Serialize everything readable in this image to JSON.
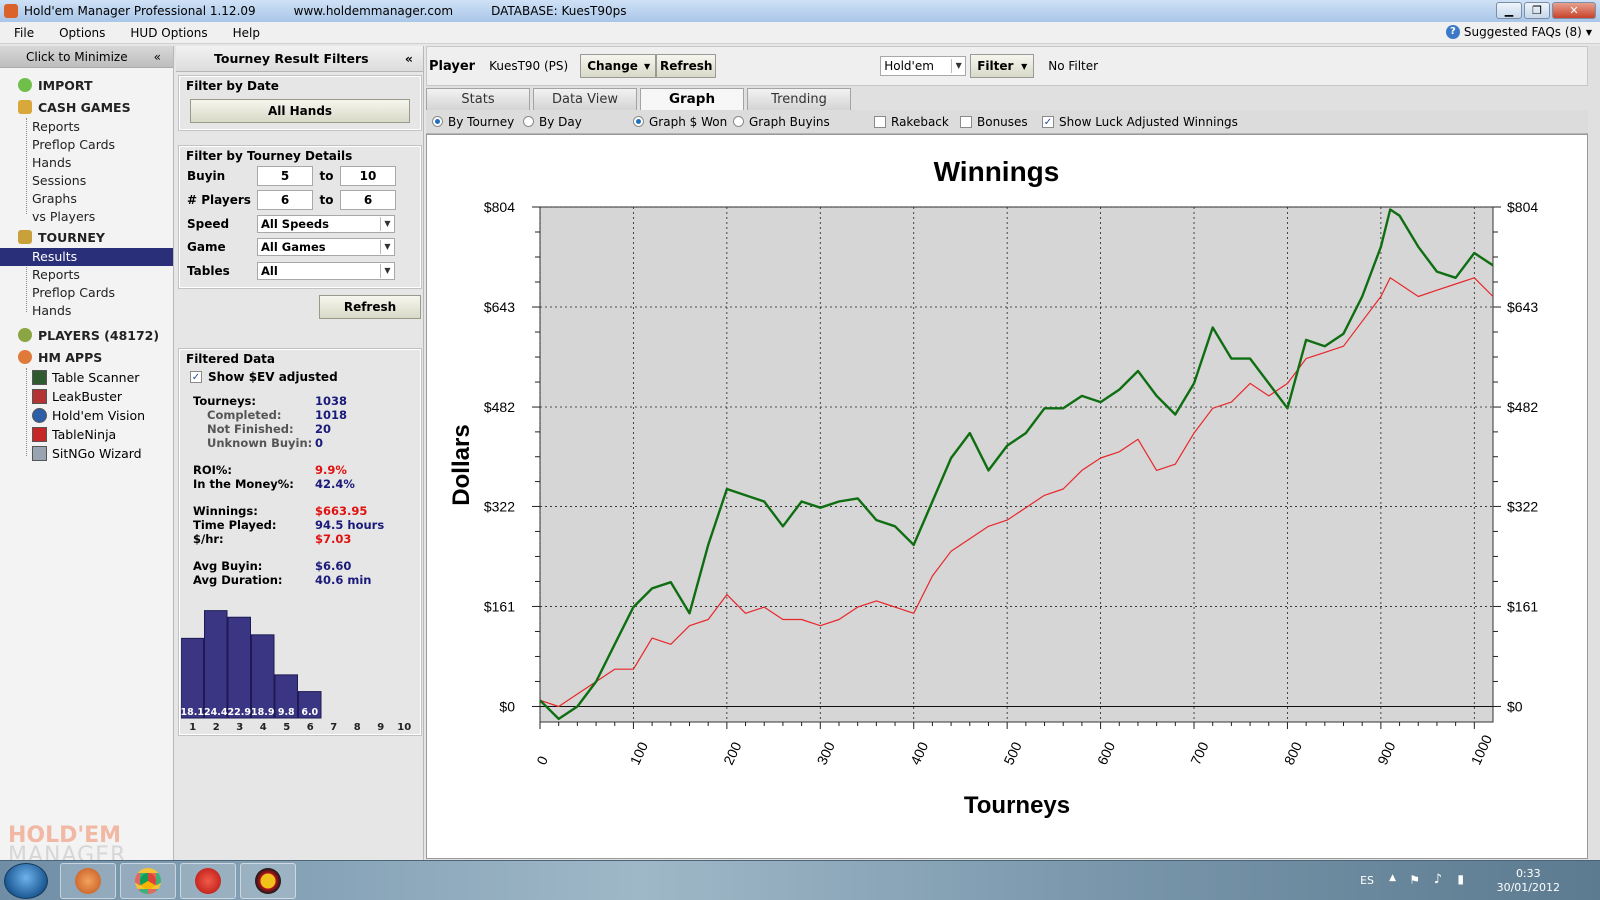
{
  "window": {
    "app_name": "Hold'em Manager Professional 1.12.09",
    "url": "www.holdemmanager.com",
    "database": "DATABASE: KuesT90ps"
  },
  "menu": [
    "File",
    "Options",
    "HUD Options",
    "Help"
  ],
  "faq": "Suggested FAQs (8)",
  "nav": {
    "minimize": "Click to Minimize",
    "import": "IMPORT",
    "cash_games": "CASH GAMES",
    "cash_items": [
      "Reports",
      "Preflop Cards",
      "Hands",
      "Sessions",
      "Graphs",
      "vs Players"
    ],
    "tourney": "TOURNEY",
    "tourney_items": [
      "Results",
      "Reports",
      "Preflop Cards",
      "Hands"
    ],
    "players": "PLAYERS (48172)",
    "hm_apps": "HM APPS",
    "apps": [
      "Table Scanner",
      "LeakBuster",
      "Hold'em Vision",
      "TableNinja",
      "SitNGo Wizard"
    ],
    "brand_top": "HOLD'EM",
    "brand_bottom": "MANAGER"
  },
  "filters": {
    "title": "Tourney Result Filters",
    "by_date_title": "Filter by Date",
    "all_hands": "All Hands",
    "details_title": "Filter by Tourney Details",
    "buyin_label": "Buyin",
    "buyin_from": "5",
    "buyin_to": "10",
    "to": "to",
    "players_label": "# Players",
    "players_from": "6",
    "players_to": "6",
    "speed_label": "Speed",
    "speed_value": "All Speeds",
    "game_label": "Game",
    "game_value": "All Games",
    "tables_label": "Tables",
    "tables_value": "All",
    "refresh": "Refresh",
    "filtered_title": "Filtered Data",
    "show_sev": "Show $EV adjusted",
    "stats": {
      "tourneys_k": "Tourneys:",
      "tourneys_v": "1038",
      "completed_k": "Completed:",
      "completed_v": "1018",
      "not_finished_k": "Not Finished:",
      "not_finished_v": "20",
      "unknown_k": "Unknown Buyin:",
      "unknown_v": "0",
      "roi_k": "ROI%:",
      "roi_v": "9.9%",
      "itm_k": "In the Money%:",
      "itm_v": "42.4%",
      "winnings_k": "Winnings:",
      "winnings_v": "$663.95",
      "time_k": "Time Played:",
      "time_v": "94.5 hours",
      "hourly_k": "$/hr:",
      "hourly_v": "$7.03",
      "avg_buyin_k": "Avg Buyin:",
      "avg_buyin_v": "$6.60",
      "avg_dur_k": "Avg Duration:",
      "avg_dur_v": "40.6 min"
    },
    "histogram": {
      "positions": [
        "1",
        "2",
        "3",
        "4",
        "5",
        "6",
        "7",
        "8",
        "9",
        "10"
      ],
      "values": [
        18.1,
        24.4,
        22.9,
        18.9,
        9.8,
        6.0,
        0,
        0,
        0,
        0
      ],
      "labels": [
        "18.1",
        "24.4",
        "22.9",
        "18.9",
        "9.8",
        "6.0",
        "",
        "",
        "",
        ""
      ],
      "bar_color": "#3b3683"
    }
  },
  "player_bar": {
    "player_label": "Player",
    "player_name": "KuesT90 (PS)",
    "change": "Change",
    "refresh": "Refresh",
    "game_select": "Hold'em",
    "filter": "Filter",
    "no_filter": "No Filter"
  },
  "tabs": [
    "Stats",
    "Data View",
    "Graph",
    "Trending"
  ],
  "options": {
    "by_tourney": "By Tourney",
    "by_day": "By Day",
    "graph_won": "Graph $ Won",
    "graph_buyins": "Graph Buyins",
    "rakeback": "Rakeback",
    "bonuses": "Bonuses",
    "luck": "Show Luck Adjusted Winnings"
  },
  "chart_data": {
    "type": "line",
    "title": "Winnings",
    "xlabel": "Tourneys",
    "ylabel": "Dollars",
    "xlim": [
      0,
      1020
    ],
    "ylim": [
      -25,
      804
    ],
    "y_ticks": [
      "$0",
      "$161",
      "$322",
      "$482",
      "$643",
      "$804"
    ],
    "y_tick_values": [
      0,
      161,
      322,
      482,
      643,
      804
    ],
    "x_ticks": [
      0,
      100,
      200,
      300,
      400,
      500,
      600,
      700,
      800,
      900,
      1000
    ],
    "grid": true,
    "series": [
      {
        "color": "#0f6e12",
        "x": [
          0,
          20,
          40,
          60,
          80,
          100,
          120,
          140,
          160,
          180,
          200,
          220,
          240,
          260,
          280,
          300,
          320,
          340,
          360,
          380,
          400,
          420,
          440,
          460,
          480,
          500,
          520,
          540,
          560,
          580,
          600,
          620,
          640,
          660,
          680,
          700,
          720,
          740,
          760,
          780,
          800,
          820,
          840,
          860,
          880,
          900,
          910,
          920,
          940,
          960,
          980,
          1000,
          1020
        ],
        "y": [
          10,
          -20,
          0,
          40,
          100,
          160,
          190,
          200,
          150,
          260,
          350,
          340,
          330,
          290,
          330,
          320,
          330,
          335,
          300,
          290,
          260,
          330,
          400,
          440,
          380,
          420,
          440,
          480,
          480,
          500,
          490,
          510,
          540,
          500,
          470,
          520,
          610,
          560,
          560,
          520,
          480,
          590,
          580,
          600,
          660,
          740,
          800,
          790,
          740,
          700,
          690,
          730,
          710
        ]
      },
      {
        "color": "#e8272b",
        "x": [
          0,
          20,
          40,
          60,
          80,
          100,
          120,
          140,
          160,
          180,
          200,
          220,
          240,
          260,
          280,
          300,
          320,
          340,
          360,
          380,
          400,
          420,
          440,
          460,
          480,
          500,
          520,
          540,
          560,
          580,
          600,
          620,
          640,
          660,
          680,
          700,
          720,
          740,
          760,
          780,
          800,
          820,
          840,
          860,
          880,
          900,
          910,
          920,
          940,
          960,
          980,
          1000,
          1020
        ],
        "y": [
          10,
          0,
          20,
          40,
          60,
          60,
          110,
          100,
          130,
          140,
          180,
          150,
          160,
          140,
          140,
          130,
          140,
          160,
          170,
          160,
          150,
          210,
          250,
          270,
          290,
          300,
          320,
          340,
          350,
          380,
          400,
          410,
          430,
          380,
          390,
          440,
          480,
          490,
          520,
          500,
          520,
          560,
          570,
          580,
          620,
          660,
          690,
          680,
          660,
          670,
          680,
          690,
          660
        ]
      }
    ]
  },
  "taskbar": {
    "lang": "ES",
    "time": "0:33",
    "date": "30/01/2012"
  }
}
